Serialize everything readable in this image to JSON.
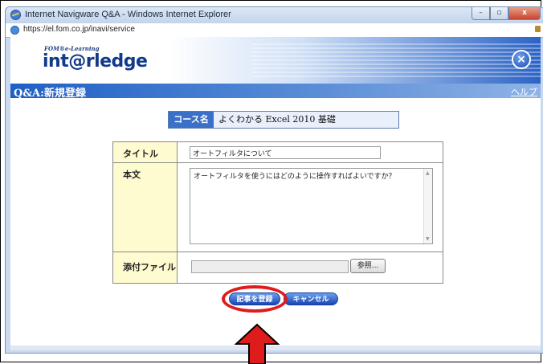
{
  "window": {
    "title": "Internet Navigware Q&A - Windows Internet Explorer",
    "url": "https://el.fom.co.jp/inavi/service",
    "buttons": {
      "minimize": "–",
      "maximize": "▫",
      "close": "x"
    }
  },
  "header": {
    "logo_small": "FOM®e-Learning",
    "logo_main_prefix": "int",
    "logo_main_at": "@",
    "logo_main_suffix": "rledge",
    "close_symbol": "×"
  },
  "section": {
    "title": "Q&A:新規登録",
    "help_label": "ヘルプ"
  },
  "course": {
    "label": "コース名",
    "value": "よくわかる Excel 2010 基礎"
  },
  "form": {
    "title_label": "タイトル",
    "title_value": "オートフィルタについて",
    "body_label": "本文",
    "body_value": "オートフィルタを使うにはどのように操作すればよいですか？",
    "attach_label": "添付ファイル",
    "browse_label": "参照..."
  },
  "actions": {
    "submit_label": "記事を登録",
    "cancel_label": "キャンセル"
  },
  "colors": {
    "highlight": "#e01b1b",
    "accent": "#1f5fc4",
    "label_bg": "#fffbd0"
  }
}
